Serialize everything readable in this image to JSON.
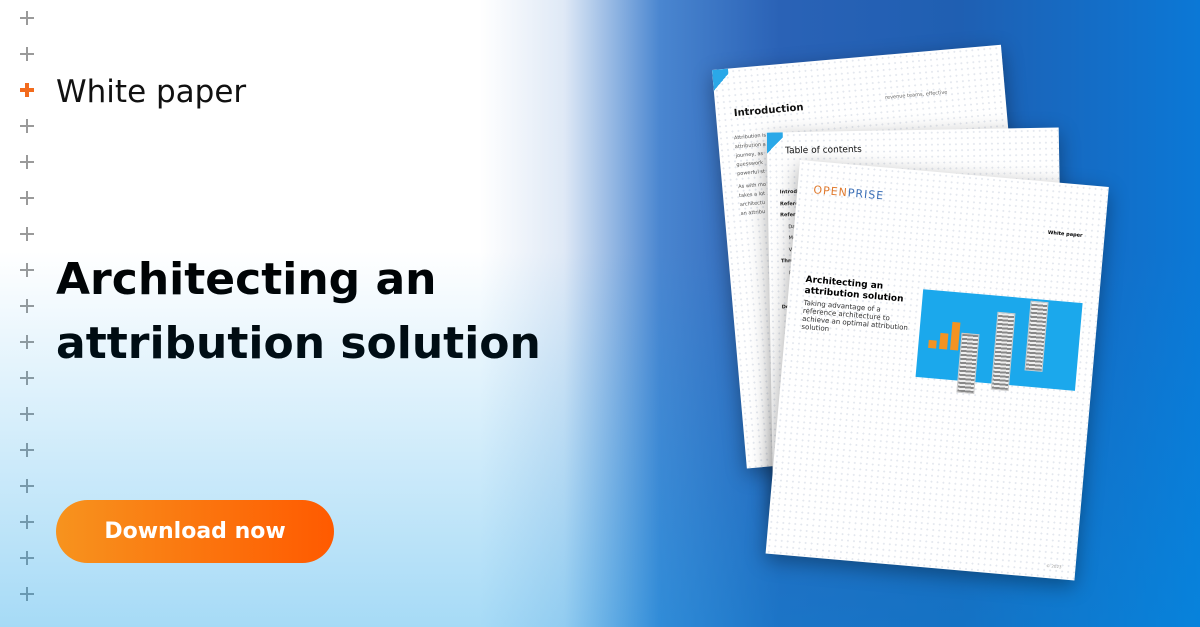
{
  "banner": {
    "eyebrow": "White paper",
    "headline": "Architecting an attribution solution",
    "cta_label": "Download now",
    "accent_color": "#f26b1d",
    "brand_blue": "#1f5fb2"
  },
  "mockup": {
    "intro_page": {
      "title": "Introduction",
      "body_fragments": [
        "Attribution is",
        "attribution a",
        "journey, as",
        "guesswork",
        "powerful st",
        "As with mo",
        "takes a lot",
        "architectu",
        "an attribu"
      ],
      "top_right_fragment": "revenue teams, effective"
    },
    "toc_page": {
      "title": "Table of contents",
      "items": [
        "Introductio",
        "Reference a",
        "Reference",
        "Data lay",
        "Model",
        "Visuali",
        "Three tec",
        "Fully",
        "Assis",
        "Nam",
        "Design"
      ]
    },
    "cover_page": {
      "logo": "OPENPRISE",
      "label": "White paper",
      "title": "Architecting an attribution solution",
      "subtitle": "Taking advantage of a reference architecture to achieve an optimal attribution solution",
      "footer": "© 2023"
    }
  }
}
